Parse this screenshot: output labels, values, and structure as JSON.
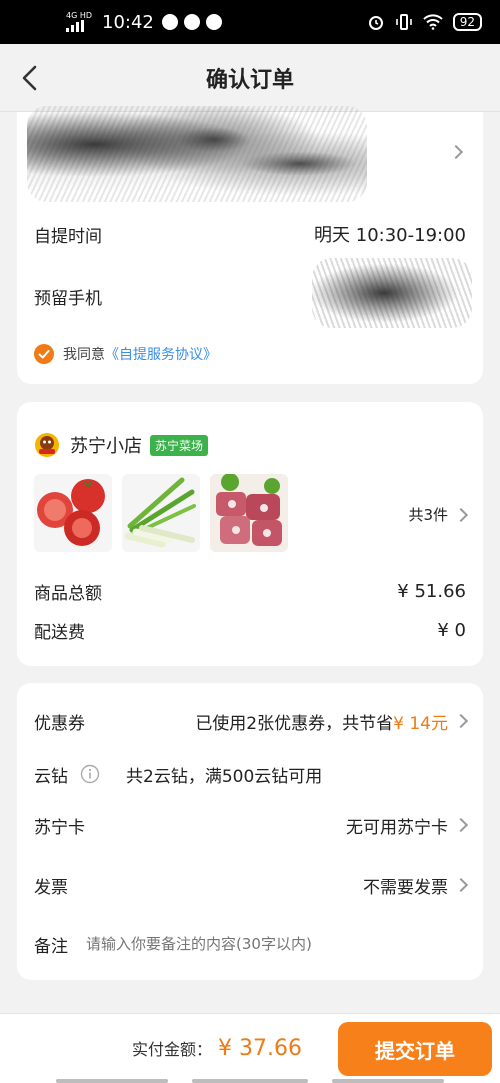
{
  "status_bar": {
    "network": "4G HD",
    "time": "10:42",
    "battery": "92"
  },
  "header": {
    "title": "确认订单"
  },
  "pickup": {
    "time_label": "自提时间",
    "time_value": "明天 10:30-19:00",
    "phone_label": "预留手机",
    "agree_prefix": "我同意",
    "agree_link": "《自提服务协议》"
  },
  "store": {
    "name": "苏宁小店",
    "tag": "苏宁菜场",
    "items_count": "共3件",
    "products": [
      "tomato",
      "green-onion",
      "pork-ribs"
    ],
    "total_label": "商品总额",
    "total_value": "¥ 51.66",
    "shipping_label": "配送费",
    "shipping_value": "¥ 0"
  },
  "options": {
    "coupon_label": "优惠券",
    "coupon_text": "已使用2张优惠券，共节省",
    "coupon_saved": "¥ 14元",
    "yunzuan_label": "云钻",
    "yunzuan_text": "共2云钻，满500云钻可用",
    "card_label": "苏宁卡",
    "card_value": "无可用苏宁卡",
    "invoice_label": "发票",
    "invoice_value": "不需要发票",
    "note_label": "备注",
    "note_placeholder": "请输入你要备注的内容(30字以内)"
  },
  "footer": {
    "pay_label": "实付金额：",
    "pay_value": "¥ 37.66",
    "submit_label": "提交订单"
  },
  "colors": {
    "accent": "#f07a15",
    "submit": "#f7801b",
    "tag_green": "#3bb34a",
    "link": "#3a8ee6"
  }
}
